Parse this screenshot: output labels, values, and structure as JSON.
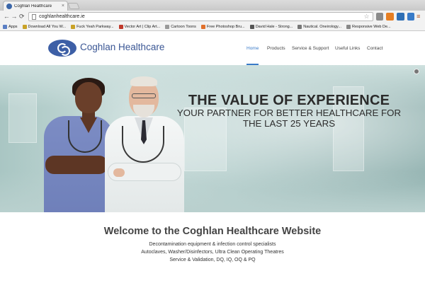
{
  "browser": {
    "tab_title": "Coghlan Healthcare",
    "url": "coghlanhealthcare.ie",
    "bookmarks": [
      {
        "label": "Apps",
        "color": "#5b7fc4"
      },
      {
        "label": "Download All You W...",
        "color": "#c9a227"
      },
      {
        "label": "Fuck Yeah Parkway...",
        "color": "#c9a227"
      },
      {
        "label": "Vector Art | Clip Art...",
        "color": "#c0392b"
      },
      {
        "label": "Cartoon Toons",
        "color": "#999999"
      },
      {
        "label": "Free Photoshop Bru...",
        "color": "#e0702c"
      },
      {
        "label": "David Hale - Strong...",
        "color": "#555555"
      },
      {
        "label": "Nautical. Oneirology...",
        "color": "#777777"
      },
      {
        "label": "Responsive Web De...",
        "color": "#888888"
      }
    ]
  },
  "site": {
    "logo_text": "Coghlan Healthcare",
    "nav": [
      "Home",
      "Products",
      "Service & Support",
      "Useful Links",
      "Contact"
    ],
    "active_nav": "Home",
    "accent_color": "#3a7bc8",
    "brand_color": "#3a5694"
  },
  "hero": {
    "title": "THE VALUE OF EXPERIENCE",
    "subtitle": "YOUR PARTNER FOR BETTER HEALTHCARE FOR THE LAST 25 YEARS"
  },
  "welcome": {
    "title": "Welcome to the Coghlan Healthcare Website",
    "lines": [
      "Decontamination equipment & infection control specialists",
      "Autoclaves, Washer/Disinfectors, Ultra Clean Operating Theatres",
      "Service & Validation, DQ, IQ, OQ & PQ"
    ]
  }
}
